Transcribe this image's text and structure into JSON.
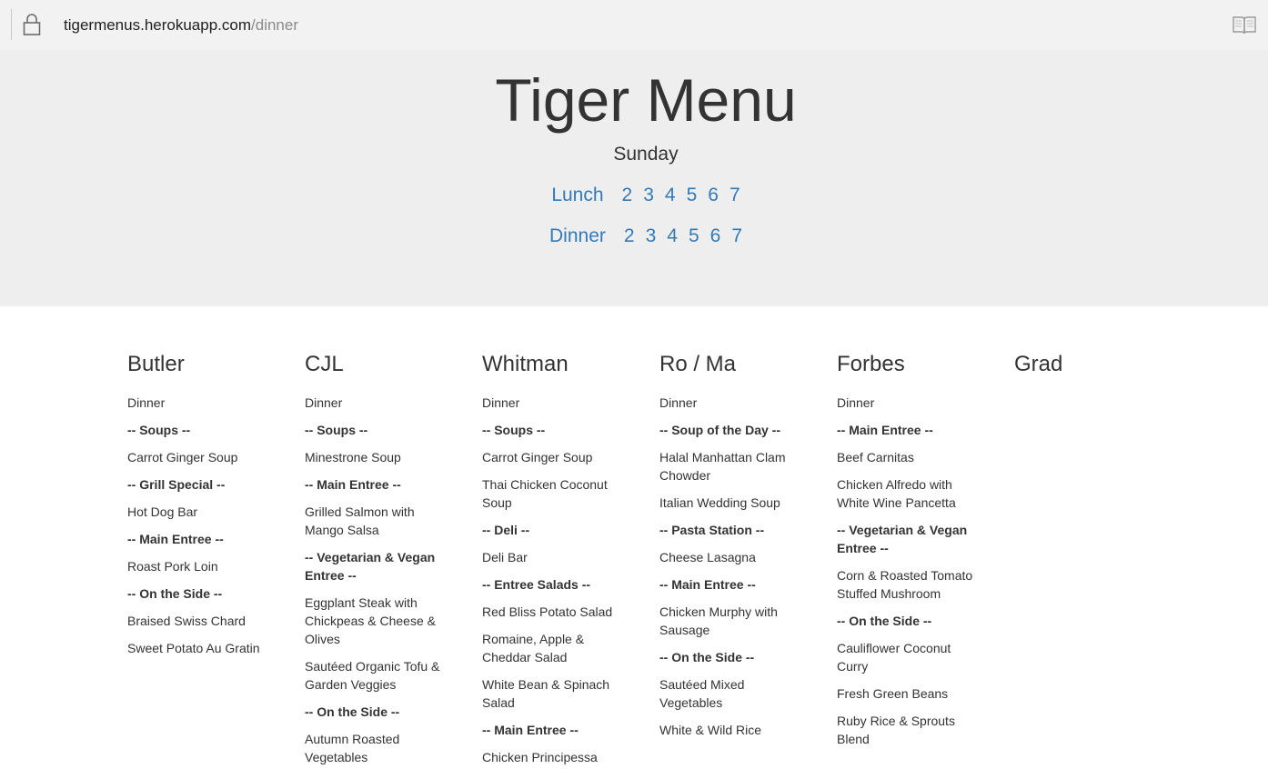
{
  "browser": {
    "url_host": "tigermenus.herokuapp.com",
    "url_path": "/dinner",
    "lock_icon": "lock-icon",
    "reader_icon": "reader-view-icon"
  },
  "header": {
    "title": "Tiger Menu",
    "day": "Sunday",
    "lunch": {
      "label": "Lunch",
      "days": [
        "2",
        "3",
        "4",
        "5",
        "6",
        "7"
      ]
    },
    "dinner": {
      "label": "Dinner",
      "days": [
        "2",
        "3",
        "4",
        "5",
        "6",
        "7"
      ]
    },
    "link_color": "#337ab7",
    "bg_color": "#eeeeee"
  },
  "halls": [
    {
      "name": "Butler",
      "items": [
        {
          "text": "Dinner",
          "cat": false
        },
        {
          "text": "-- Soups --",
          "cat": true
        },
        {
          "text": "Carrot Ginger Soup",
          "cat": false
        },
        {
          "text": "-- Grill Special --",
          "cat": true
        },
        {
          "text": "Hot Dog Bar",
          "cat": false
        },
        {
          "text": "-- Main Entree --",
          "cat": true
        },
        {
          "text": "Roast Pork Loin",
          "cat": false
        },
        {
          "text": "-- On the Side --",
          "cat": true
        },
        {
          "text": "Braised Swiss Chard",
          "cat": false
        },
        {
          "text": "Sweet Potato Au Gratin",
          "cat": false
        }
      ]
    },
    {
      "name": "CJL",
      "items": [
        {
          "text": "Dinner",
          "cat": false
        },
        {
          "text": "-- Soups --",
          "cat": true
        },
        {
          "text": "Minestrone Soup",
          "cat": false
        },
        {
          "text": "-- Main Entree --",
          "cat": true
        },
        {
          "text": "Grilled Salmon with Mango Salsa",
          "cat": false
        },
        {
          "text": "-- Vegetarian & Vegan Entree --",
          "cat": true
        },
        {
          "text": "Eggplant Steak with Chickpeas & Cheese & Olives",
          "cat": false
        },
        {
          "text": "Sautéed Organic Tofu & Garden Veggies",
          "cat": false
        },
        {
          "text": "-- On the Side --",
          "cat": true
        },
        {
          "text": "Autumn Roasted Vegetables",
          "cat": false
        }
      ]
    },
    {
      "name": "Whitman",
      "items": [
        {
          "text": "Dinner",
          "cat": false
        },
        {
          "text": "-- Soups --",
          "cat": true
        },
        {
          "text": "Carrot Ginger Soup",
          "cat": false
        },
        {
          "text": "Thai Chicken Coconut Soup",
          "cat": false
        },
        {
          "text": "-- Deli --",
          "cat": true
        },
        {
          "text": "Deli Bar",
          "cat": false
        },
        {
          "text": "-- Entree Salads --",
          "cat": true
        },
        {
          "text": "Red Bliss Potato Salad",
          "cat": false
        },
        {
          "text": "Romaine, Apple & Cheddar Salad",
          "cat": false
        },
        {
          "text": "White Bean & Spinach Salad",
          "cat": false
        },
        {
          "text": "-- Main Entree --",
          "cat": true
        },
        {
          "text": "Chicken Principessa",
          "cat": false
        }
      ]
    },
    {
      "name": "Ro / Ma",
      "items": [
        {
          "text": "Dinner",
          "cat": false
        },
        {
          "text": "-- Soup of the Day --",
          "cat": true
        },
        {
          "text": "Halal Manhattan Clam Chowder",
          "cat": false
        },
        {
          "text": "Italian Wedding Soup",
          "cat": false
        },
        {
          "text": "-- Pasta Station --",
          "cat": true
        },
        {
          "text": "Cheese Lasagna",
          "cat": false
        },
        {
          "text": "-- Main Entree --",
          "cat": true
        },
        {
          "text": "Chicken Murphy with Sausage",
          "cat": false
        },
        {
          "text": "-- On the Side --",
          "cat": true
        },
        {
          "text": "Sautéed Mixed Vegetables",
          "cat": false
        },
        {
          "text": "White & Wild Rice",
          "cat": false
        }
      ]
    },
    {
      "name": "Forbes",
      "items": [
        {
          "text": "Dinner",
          "cat": false
        },
        {
          "text": "-- Main Entree --",
          "cat": true
        },
        {
          "text": "Beef Carnitas",
          "cat": false
        },
        {
          "text": "Chicken Alfredo with White Wine Pancetta",
          "cat": false
        },
        {
          "text": "-- Vegetarian & Vegan Entree --",
          "cat": true
        },
        {
          "text": "Corn & Roasted Tomato Stuffed Mushroom",
          "cat": false
        },
        {
          "text": "-- On the Side --",
          "cat": true
        },
        {
          "text": "Cauliflower Coconut Curry",
          "cat": false
        },
        {
          "text": "Fresh Green Beans",
          "cat": false
        },
        {
          "text": "Ruby Rice & Sprouts Blend",
          "cat": false
        }
      ]
    },
    {
      "name": "Grad",
      "items": []
    }
  ]
}
